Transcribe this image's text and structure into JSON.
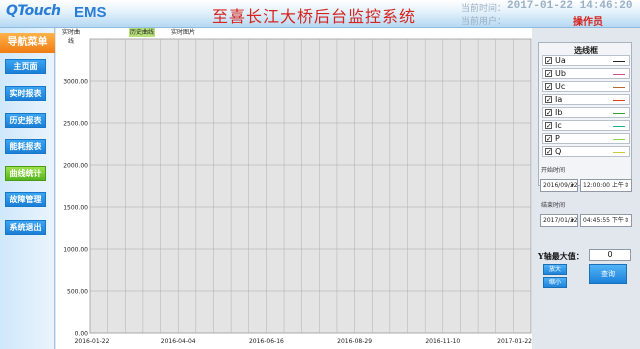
{
  "header": {
    "logo": "QTouch",
    "product": "EMS",
    "title": "至喜长江大桥后台监控系统",
    "time_label": "当前时间：",
    "time_value": "2017-01-22  14:46:20",
    "user_label": "当前用户：",
    "user_value": "操作员"
  },
  "sidebar": {
    "title": "导航菜单",
    "items": [
      {
        "label": "主页面"
      },
      {
        "label": "实时报表"
      },
      {
        "label": "历史报表"
      },
      {
        "label": "能耗报表"
      },
      {
        "label": "曲线统计"
      },
      {
        "label": "故障管理"
      },
      {
        "label": "系统退出"
      }
    ],
    "active_index": 4
  },
  "chart_tabs": [
    "实时曲线",
    "历史曲线",
    "实时图片"
  ],
  "chart_data": {
    "type": "line",
    "ylim": [
      0,
      3500
    ],
    "yticks": [
      "0.00",
      "500.00",
      "1000.00",
      "1500.00",
      "2000.00",
      "2500.00",
      "3000.00"
    ],
    "xticks": [
      "2016-01-22",
      "2016-04-04",
      "2016-06-16",
      "2016-08-29",
      "2016-11-10",
      "2017-01-22"
    ],
    "grid": true,
    "series": []
  },
  "legend": {
    "title": "选线框",
    "items": [
      {
        "name": "Ua",
        "color": "#222222"
      },
      {
        "name": "Ub",
        "color": "#d34f91"
      },
      {
        "name": "Uc",
        "color": "#b36a2e"
      },
      {
        "name": "Ia",
        "color": "#e0401c"
      },
      {
        "name": "Ib",
        "color": "#2fa22f"
      },
      {
        "name": "Ic",
        "color": "#18b08a"
      },
      {
        "name": "P",
        "color": "#8ed64a"
      },
      {
        "name": "Q",
        "color": "#c9c93a"
      }
    ]
  },
  "start": {
    "label": "开始时间",
    "date": "2016/09/22",
    "time": "12:00:00 上午"
  },
  "end": {
    "label": "结束时间",
    "date": "2017/01/22",
    "time": "04:45:55 下午"
  },
  "ymax": {
    "label": "Y轴最大值：",
    "value": "0"
  },
  "buttons": {
    "zoom_in": "放大",
    "zoom_out": "缩小",
    "query": "查询"
  }
}
